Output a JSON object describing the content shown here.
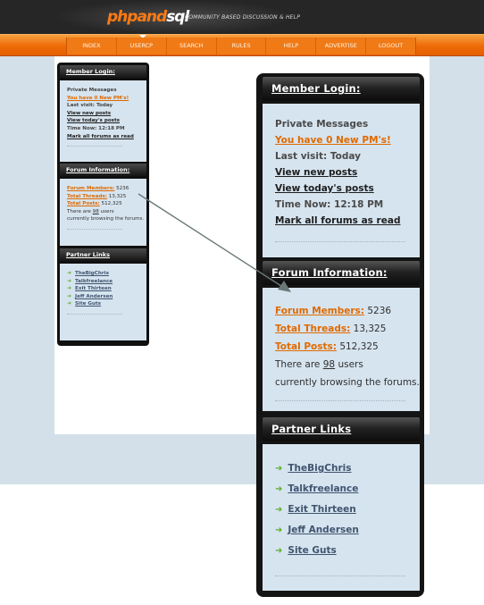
{
  "header": {
    "logo_prefix": "phpand",
    "logo_suffix": "sql",
    "tagline": "COMMUNITY BASED DISCUSSION & HELP"
  },
  "nav": [
    "INDEX",
    "USERCP",
    "SEARCH",
    "RULES",
    "HELP",
    "ADVERTISE",
    "LOGOUT"
  ],
  "member_login": {
    "title": "Member Login:",
    "private_messages": "Private Messages",
    "new_pms": "You have 0 New PM's!",
    "last_visit": "Last visit: Today",
    "view_new_posts": "View new posts",
    "view_todays_posts": "View today's posts",
    "time_now": "Time Now: 12:18 PM",
    "mark_all_read": "Mark all forums as read"
  },
  "forum_info": {
    "title": "Forum Information:",
    "members_label": "Forum Members:",
    "members_value": "5236",
    "threads_label": "Total Threads:",
    "threads_value": "13,325",
    "posts_label": "Total Posts:",
    "posts_value": "512,325",
    "browsing_prefix": "There are",
    "browsing_count": "98",
    "browsing_suffix": "users",
    "browsing_line2": "currently browsing the forums."
  },
  "partner_links": {
    "title": "Partner Links",
    "items": [
      "TheBigChris",
      "Talkfreelance",
      "Exit Thirteen",
      "Jeff Andersen",
      "Site Guts"
    ]
  },
  "colors": {
    "accent_orange": "#ee6a07",
    "panel_blue": "#d6e4ef",
    "widget_black": "#141414",
    "link_orange": "#e06a00",
    "partner_link": "#405470"
  }
}
